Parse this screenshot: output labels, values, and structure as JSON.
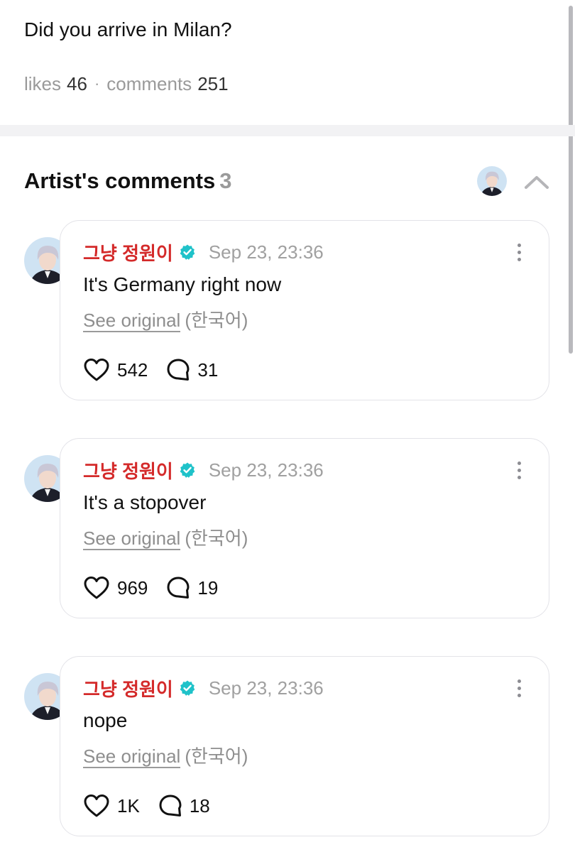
{
  "post": {
    "text": "Did you arrive in Milan?",
    "likes_label": "likes",
    "likes_count": "46",
    "separator": "·",
    "comments_label": "comments",
    "comments_count": "251"
  },
  "artist_section": {
    "title": "Artist's comments",
    "count": "3",
    "collapse_icon": "chevron-up-icon"
  },
  "comments": [
    {
      "author": "그냥 정원이",
      "verified_icon": "verified-badge-icon",
      "time": "Sep 23, 23:36",
      "text": "It's Germany right now",
      "see_original": "See original",
      "language": "(한국어)",
      "likes": "542",
      "replies": "31"
    },
    {
      "author": "그냥 정원이",
      "verified_icon": "verified-badge-icon",
      "time": "Sep 23, 23:36",
      "text": "It's a stopover",
      "see_original": "See original",
      "language": "(한국어)",
      "likes": "969",
      "replies": "19"
    },
    {
      "author": "그냥 정원이",
      "verified_icon": "verified-badge-icon",
      "time": "Sep 23, 23:36",
      "text": "nope",
      "see_original": "See original",
      "language": "(한국어)",
      "likes": "1K",
      "replies": "18"
    }
  ],
  "colors": {
    "author_red": "#d42a2a",
    "verified_teal": "#1fc2c9",
    "muted_gray": "#9a9a9a",
    "card_border": "#e3e3e8"
  }
}
